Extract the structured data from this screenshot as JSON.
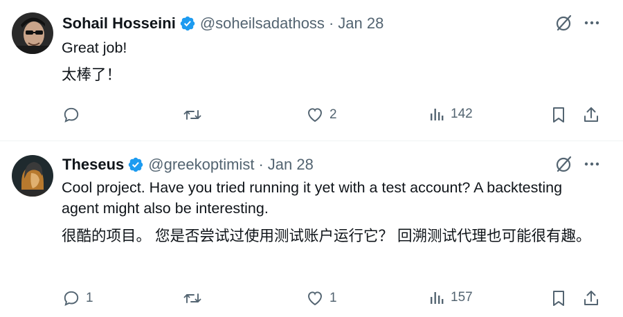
{
  "tweets": [
    {
      "author_name": "Sohail Hosseini",
      "handle": "@soheilsadathoss",
      "separator": "·",
      "date": "Jan 28",
      "text_en": "Great job!",
      "text_zh": "太棒了！",
      "reply_count": "",
      "retweet_count": "",
      "like_count": "2",
      "view_count": "142"
    },
    {
      "author_name": "Theseus",
      "handle": "@greekoptimist",
      "separator": "·",
      "date": "Jan 28",
      "text_en": "Cool project.  Have you tried running it yet with a test account?  A backtesting agent might also be interesting.",
      "text_zh": "很酷的项目。 您是否尝试过使用测试账户运行它？ 回溯测试代理也可能很有趣。",
      "reply_count": "1",
      "retweet_count": "",
      "like_count": "1",
      "view_count": "157"
    }
  ],
  "colors": {
    "text_primary": "#0f1419",
    "text_secondary": "#536471",
    "verified_blue": "#1d9bf0",
    "divider": "#eff3f4"
  },
  "icons": [
    "verified-badge-icon",
    "grok-icon",
    "more-icon",
    "reply-icon",
    "retweet-icon",
    "like-icon",
    "views-icon",
    "bookmark-icon",
    "share-icon"
  ]
}
